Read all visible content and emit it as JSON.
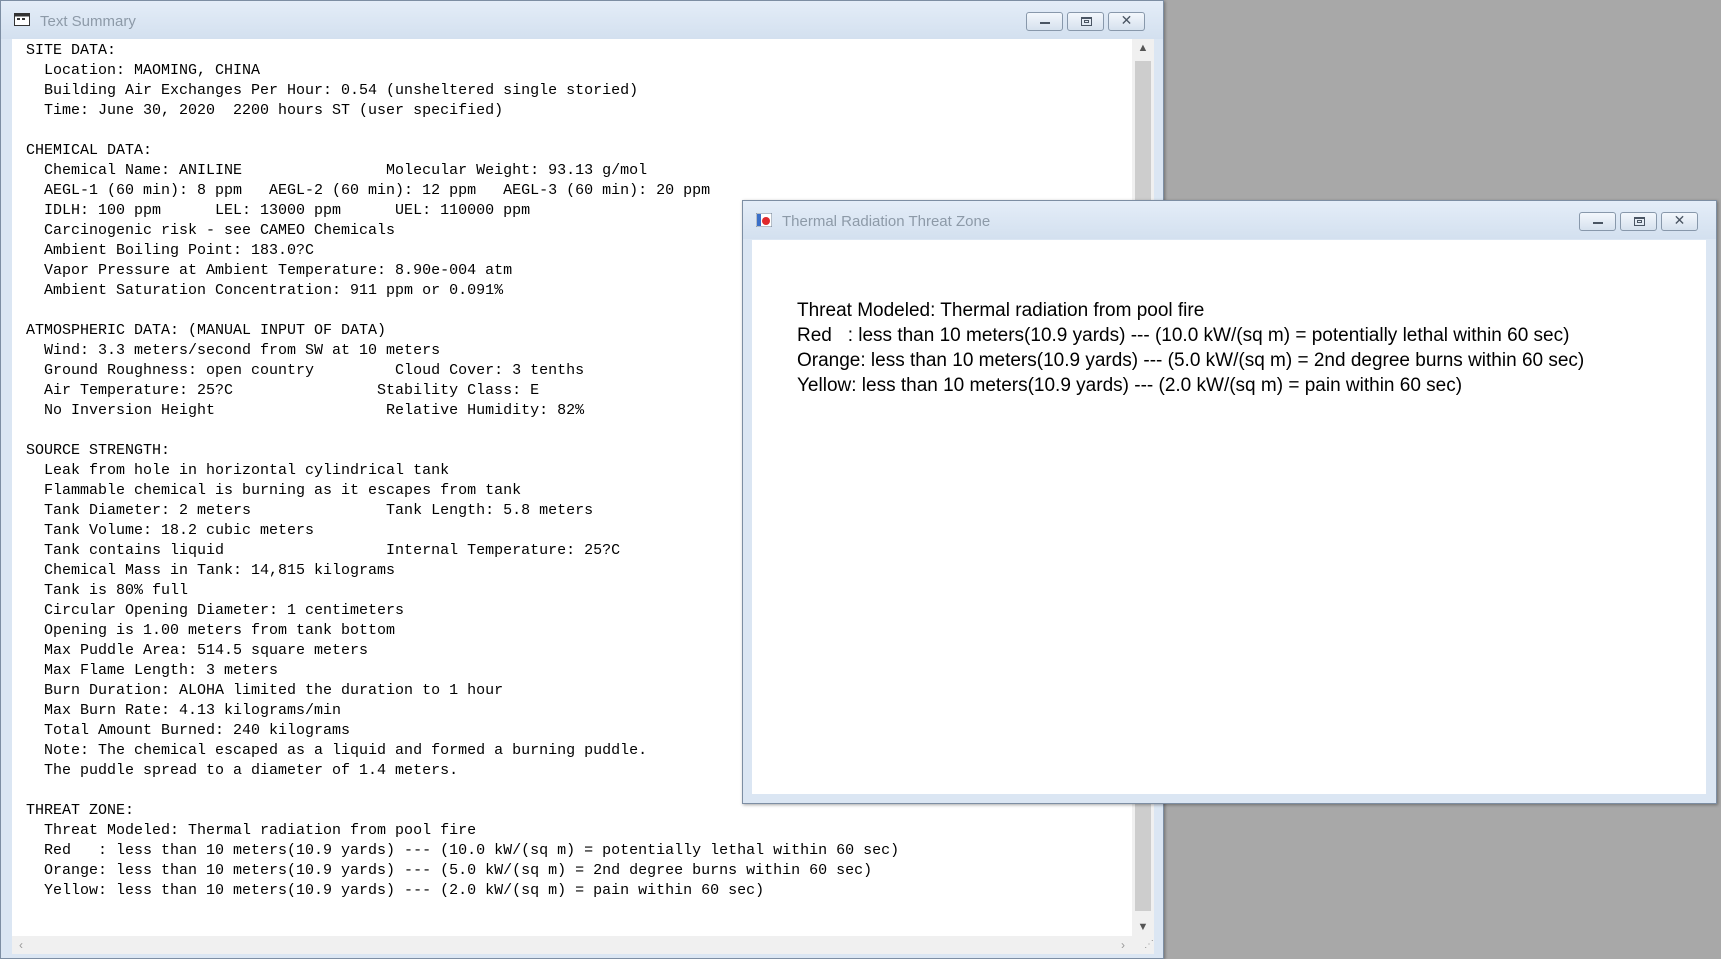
{
  "summary_window": {
    "title": "Text Summary",
    "icon": "text-window-icon",
    "lines": [
      "SITE DATA:",
      "  Location: MAOMING, CHINA",
      "  Building Air Exchanges Per Hour: 0.54 (unsheltered single storied)",
      "  Time: June 30, 2020  2200 hours ST (user specified)",
      "",
      "CHEMICAL DATA:",
      "  Chemical Name: ANILINE                Molecular Weight: 93.13 g/mol",
      "  AEGL-1 (60 min): 8 ppm   AEGL-2 (60 min): 12 ppm   AEGL-3 (60 min): 20 ppm",
      "  IDLH: 100 ppm      LEL: 13000 ppm      UEL: 110000 ppm",
      "  Carcinogenic risk - see CAMEO Chemicals",
      "  Ambient Boiling Point: 183.0?C",
      "  Vapor Pressure at Ambient Temperature: 8.90e-004 atm",
      "  Ambient Saturation Concentration: 911 ppm or 0.091%",
      "",
      "ATMOSPHERIC DATA: (MANUAL INPUT OF DATA)",
      "  Wind: 3.3 meters/second from SW at 10 meters",
      "  Ground Roughness: open country         Cloud Cover: 3 tenths",
      "  Air Temperature: 25?C                Stability Class: E",
      "  No Inversion Height                   Relative Humidity: 82%",
      "",
      "SOURCE STRENGTH:",
      "  Leak from hole in horizontal cylindrical tank",
      "  Flammable chemical is burning as it escapes from tank",
      "  Tank Diameter: 2 meters               Tank Length: 5.8 meters",
      "  Tank Volume: 18.2 cubic meters",
      "  Tank contains liquid                  Internal Temperature: 25?C",
      "  Chemical Mass in Tank: 14,815 kilograms",
      "  Tank is 80% full",
      "  Circular Opening Diameter: 1 centimeters",
      "  Opening is 1.00 meters from tank bottom",
      "  Max Puddle Area: 514.5 square meters",
      "  Max Flame Length: 3 meters",
      "  Burn Duration: ALOHA limited the duration to 1 hour",
      "  Max Burn Rate: 4.13 kilograms/min",
      "  Total Amount Burned: 240 kilograms",
      "  Note: The chemical escaped as a liquid and formed a burning puddle.",
      "  The puddle spread to a diameter of 1.4 meters.",
      "",
      "THREAT ZONE:",
      "  Threat Modeled: Thermal radiation from pool fire",
      "  Red   : less than 10 meters(10.9 yards) --- (10.0 kW/(sq m) = potentially lethal within 60 sec)",
      "  Orange: less than 10 meters(10.9 yards) --- (5.0 kW/(sq m) = 2nd degree burns within 60 sec)",
      "  Yellow: less than 10 meters(10.9 yards) --- (2.0 kW/(sq m) = pain within 60 sec)"
    ]
  },
  "thermal_window": {
    "title": "Thermal Radiation Threat Zone",
    "icon": "threat-zone-icon",
    "lines": [
      "Threat Modeled: Thermal radiation from pool fire",
      "Red   : less than 10 meters(10.9 yards) --- (10.0 kW/(sq m) = potentially lethal within 60 sec)",
      "Orange: less than 10 meters(10.9 yards) --- (5.0 kW/(sq m) = 2nd degree burns within 60 sec)",
      "Yellow: less than 10 meters(10.9 yards) --- (2.0 kW/(sq m) = pain within 60 sec)"
    ]
  },
  "controls": {
    "minimize_icon": "minimize-icon",
    "maximize_icon": "maximize-icon",
    "close_icon": "close-icon",
    "close_glyph": "✕"
  },
  "scroll": {
    "up_glyph": "▲",
    "down_glyph": "▼",
    "left_glyph": "‹",
    "right_glyph": "›",
    "grip_glyph": "⋰"
  }
}
